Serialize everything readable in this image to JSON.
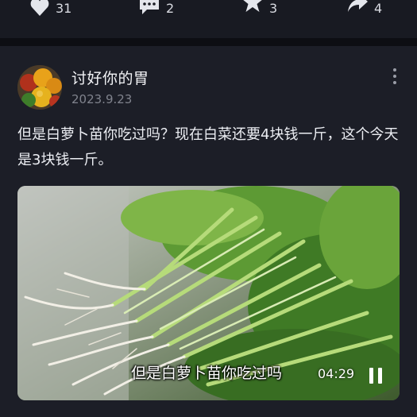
{
  "actions": {
    "like": {
      "icon": "heart-icon",
      "count": "31"
    },
    "comment": {
      "icon": "comment-bubble-icon",
      "count": "2"
    },
    "favorite": {
      "icon": "star-icon",
      "count": "3"
    },
    "share": {
      "icon": "share-arrow-icon",
      "count": "4"
    }
  },
  "post": {
    "author": "讨好你的胃",
    "date": "2023.9.23",
    "text": "但是白萝卜苗你吃过吗？现在白菜还要4块钱一斤，这个今天是3块钱一斤。",
    "more_icon": "more-vertical-icon",
    "video": {
      "caption": "但是白萝卜苗你吃过吗",
      "duration": "04:29",
      "control_icon": "pause-icon"
    }
  },
  "colors": {
    "background": "#14151c",
    "card": "#1c1e27",
    "text_secondary": "#80838d"
  }
}
